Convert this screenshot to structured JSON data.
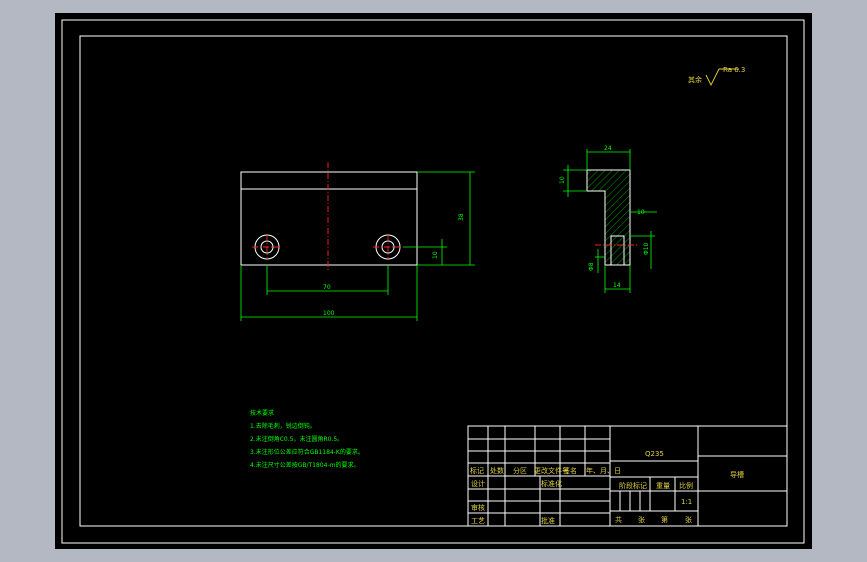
{
  "drawing": {
    "roughness_symbol": "Ra 6.3",
    "roughness_prefix": "其余",
    "dims_front": {
      "width": "100",
      "hole_spacing": "70",
      "height": "38",
      "hole_offset": "10"
    },
    "dims_side": {
      "top_width": "24",
      "top_thickness": "10",
      "stem_width": "14",
      "stem_label": "10",
      "hole_dia": "Φ10",
      "hole_depth": "Φ8"
    },
    "notes": {
      "title": "技术要求",
      "lines": [
        "1.去除毛刺，锐边倒钝。",
        "2.未注倒角C0.5，未注圆角R0.5。",
        "3.未注形位公差应符合GB1184-K的要求。",
        "4.未注尺寸公差按GB/T1804-m的要求。"
      ]
    },
    "title_block": {
      "material": "Q235",
      "part_name": "导槽",
      "headers": [
        "标记",
        "处数",
        "分区",
        "更改文件号",
        "签名",
        "年、月、日"
      ],
      "design": "设计",
      "standard": "标准化",
      "review": "审核",
      "process": "工艺",
      "approve": "批准",
      "stage_mark": "阶段标记",
      "weight": "重量",
      "scale": "比例",
      "scale_value": "1:1",
      "sheets": [
        "共",
        "张",
        "第",
        "张"
      ]
    }
  }
}
